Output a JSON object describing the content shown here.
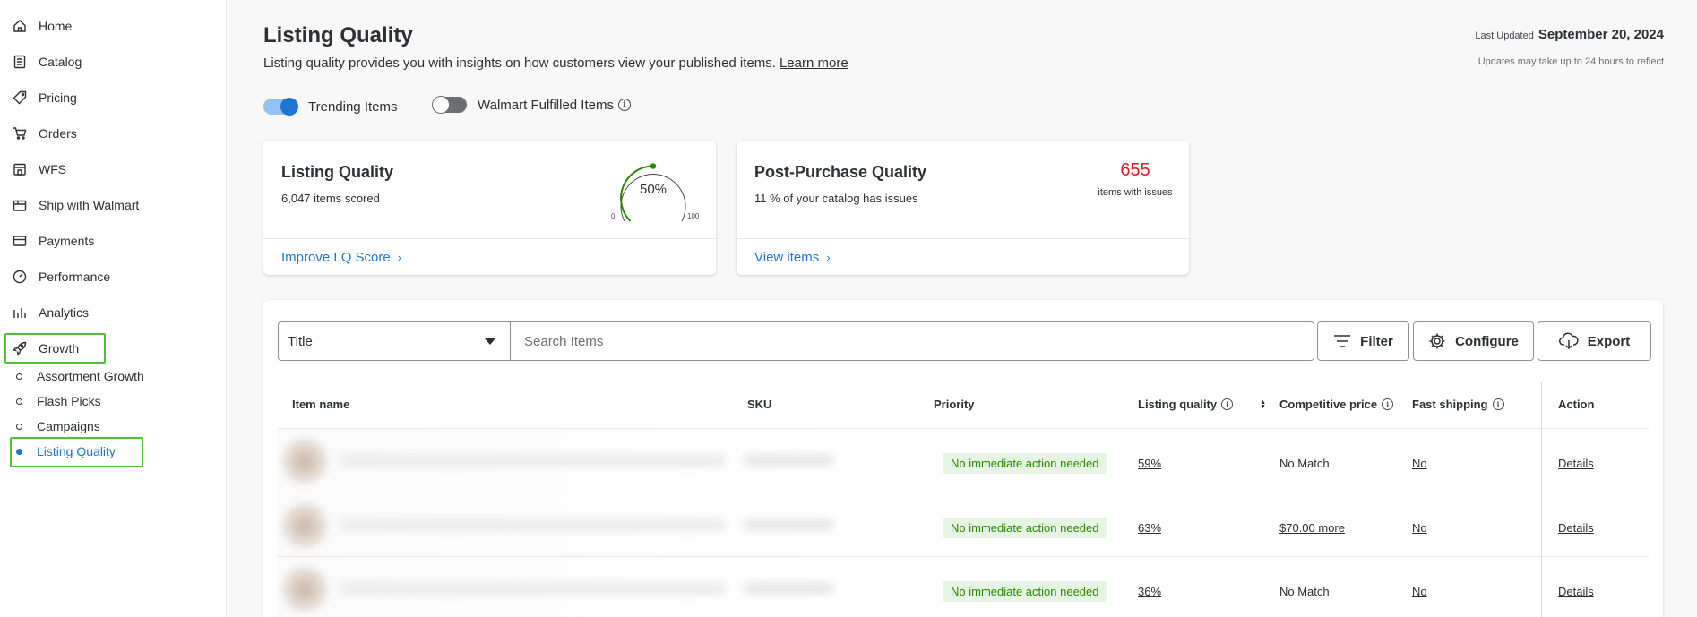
{
  "sidebar": {
    "items": [
      {
        "label": "Home",
        "icon": "home-icon"
      },
      {
        "label": "Catalog",
        "icon": "catalog-icon"
      },
      {
        "label": "Pricing",
        "icon": "tag-icon"
      },
      {
        "label": "Orders",
        "icon": "cart-icon"
      },
      {
        "label": "WFS",
        "icon": "warehouse-icon"
      },
      {
        "label": "Ship with Walmart",
        "icon": "box-icon"
      },
      {
        "label": "Payments",
        "icon": "card-icon"
      },
      {
        "label": "Performance",
        "icon": "gauge-icon"
      },
      {
        "label": "Analytics",
        "icon": "bar-chart-icon"
      },
      {
        "label": "Growth",
        "icon": "rocket-icon"
      }
    ],
    "sub_items": [
      {
        "label": "Assortment Growth"
      },
      {
        "label": "Flash Picks"
      },
      {
        "label": "Campaigns"
      },
      {
        "label": "Listing Quality",
        "active": true
      }
    ],
    "highlight_color": "#53c03b",
    "active_color": "#1e76d2"
  },
  "header": {
    "title": "Listing Quality",
    "description": "Listing quality provides you with insights on how customers view your published items.",
    "learn_more": "Learn more",
    "last_updated_label": "Last Updated",
    "last_updated_date": "September 20, 2024",
    "update_note": "Updates may take up to 24 hours to reflect"
  },
  "toggles": {
    "trending": {
      "label": "Trending Items",
      "on": true
    },
    "wfs": {
      "label": "Walmart Fulfilled Items",
      "on": false
    }
  },
  "cards": {
    "listing_quality": {
      "title": "Listing Quality",
      "subtitle": "6,047 items scored",
      "score": "50%",
      "score_value": 50,
      "gauge_min": "0",
      "gauge_max": "100",
      "link": "Improve LQ Score"
    },
    "post_purchase": {
      "title": "Post-Purchase Quality",
      "subtitle": "11 % of your catalog has issues",
      "issues_count": "655",
      "issues_label": "items with issues",
      "link": "View items"
    }
  },
  "toolbar": {
    "select_value": "Title",
    "search_placeholder": "Search Items",
    "filter_label": "Filter",
    "configure_label": "Configure",
    "export_label": "Export"
  },
  "table": {
    "columns": {
      "item_name": "Item name",
      "sku": "SKU",
      "priority": "Priority",
      "listing_quality": "Listing quality",
      "competitive_price": "Competitive price",
      "fast_shipping": "Fast shipping",
      "action": "Action"
    },
    "rows": [
      {
        "priority": "No immediate action needed",
        "listing_quality": "59%",
        "competitive_price": "No Match",
        "price_link": false,
        "fast_shipping": "No",
        "action": "Details"
      },
      {
        "priority": "No immediate action needed",
        "listing_quality": "63%",
        "competitive_price": "$70.00 more",
        "price_link": true,
        "fast_shipping": "No",
        "action": "Details"
      },
      {
        "priority": "No immediate action needed",
        "listing_quality": "36%",
        "competitive_price": "No Match",
        "price_link": false,
        "fast_shipping": "No",
        "action": "Details"
      }
    ]
  }
}
